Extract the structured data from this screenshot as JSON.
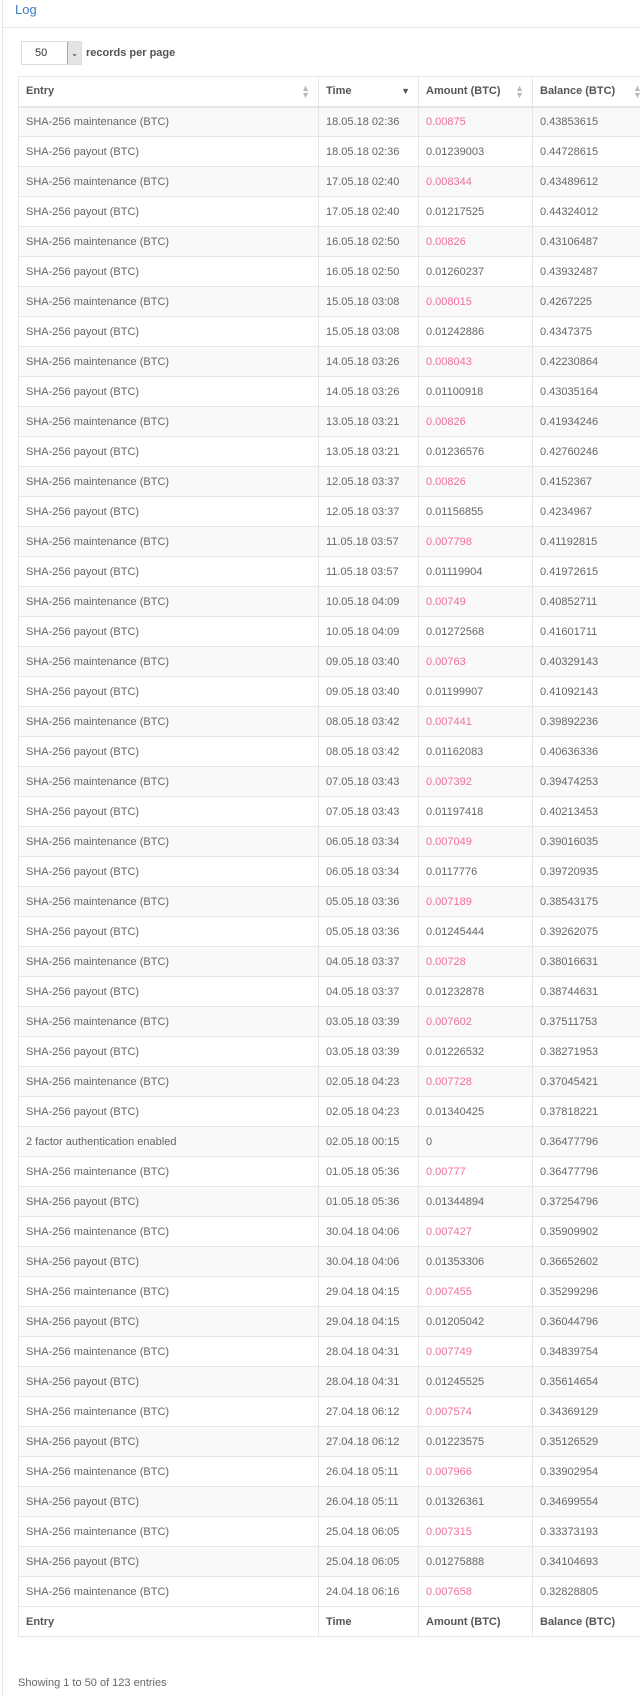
{
  "title": "Log",
  "length_menu": {
    "value": "50",
    "label": "records per page"
  },
  "columns": [
    "Entry",
    "Time",
    "Amount (BTC)",
    "Balance (BTC)"
  ],
  "sort": {
    "column": "Time",
    "direction": "desc"
  },
  "colors": {
    "negative_amount": "#f06ea0",
    "title": "#3b7dc0"
  },
  "rows": [
    {
      "entry": "SHA-256 maintenance (BTC)",
      "time": "18.05.18 02:36",
      "amount": "0.00875",
      "balance": "0.43853615",
      "negative": true
    },
    {
      "entry": "SHA-256 payout (BTC)",
      "time": "18.05.18 02:36",
      "amount": "0.01239003",
      "balance": "0.44728615",
      "negative": false
    },
    {
      "entry": "SHA-256 maintenance (BTC)",
      "time": "17.05.18 02:40",
      "amount": "0.008344",
      "balance": "0.43489612",
      "negative": true
    },
    {
      "entry": "SHA-256 payout (BTC)",
      "time": "17.05.18 02:40",
      "amount": "0.01217525",
      "balance": "0.44324012",
      "negative": false
    },
    {
      "entry": "SHA-256 maintenance (BTC)",
      "time": "16.05.18 02:50",
      "amount": "0.00826",
      "balance": "0.43106487",
      "negative": true
    },
    {
      "entry": "SHA-256 payout (BTC)",
      "time": "16.05.18 02:50",
      "amount": "0.01260237",
      "balance": "0.43932487",
      "negative": false
    },
    {
      "entry": "SHA-256 maintenance (BTC)",
      "time": "15.05.18 03:08",
      "amount": "0.008015",
      "balance": "0.4267225",
      "negative": true
    },
    {
      "entry": "SHA-256 payout (BTC)",
      "time": "15.05.18 03:08",
      "amount": "0.01242886",
      "balance": "0.4347375",
      "negative": false
    },
    {
      "entry": "SHA-256 maintenance (BTC)",
      "time": "14.05.18 03:26",
      "amount": "0.008043",
      "balance": "0.42230864",
      "negative": true
    },
    {
      "entry": "SHA-256 payout (BTC)",
      "time": "14.05.18 03:26",
      "amount": "0.01100918",
      "balance": "0.43035164",
      "negative": false
    },
    {
      "entry": "SHA-256 maintenance (BTC)",
      "time": "13.05.18 03:21",
      "amount": "0.00826",
      "balance": "0.41934246",
      "negative": true
    },
    {
      "entry": "SHA-256 payout (BTC)",
      "time": "13.05.18 03:21",
      "amount": "0.01236576",
      "balance": "0.42760246",
      "negative": false
    },
    {
      "entry": "SHA-256 maintenance (BTC)",
      "time": "12.05.18 03:37",
      "amount": "0.00826",
      "balance": "0.4152367",
      "negative": true
    },
    {
      "entry": "SHA-256 payout (BTC)",
      "time": "12.05.18 03:37",
      "amount": "0.01156855",
      "balance": "0.4234967",
      "negative": false
    },
    {
      "entry": "SHA-256 maintenance (BTC)",
      "time": "11.05.18 03:57",
      "amount": "0.007798",
      "balance": "0.41192815",
      "negative": true
    },
    {
      "entry": "SHA-256 payout (BTC)",
      "time": "11.05.18 03:57",
      "amount": "0.01119904",
      "balance": "0.41972615",
      "negative": false
    },
    {
      "entry": "SHA-256 maintenance (BTC)",
      "time": "10.05.18 04:09",
      "amount": "0.00749",
      "balance": "0.40852711",
      "negative": true
    },
    {
      "entry": "SHA-256 payout (BTC)",
      "time": "10.05.18 04:09",
      "amount": "0.01272568",
      "balance": "0.41601711",
      "negative": false
    },
    {
      "entry": "SHA-256 maintenance (BTC)",
      "time": "09.05.18 03:40",
      "amount": "0.00763",
      "balance": "0.40329143",
      "negative": true
    },
    {
      "entry": "SHA-256 payout (BTC)",
      "time": "09.05.18 03:40",
      "amount": "0.01199907",
      "balance": "0.41092143",
      "negative": false
    },
    {
      "entry": "SHA-256 maintenance (BTC)",
      "time": "08.05.18 03:42",
      "amount": "0.007441",
      "balance": "0.39892236",
      "negative": true
    },
    {
      "entry": "SHA-256 payout (BTC)",
      "time": "08.05.18 03:42",
      "amount": "0.01162083",
      "balance": "0.40636336",
      "negative": false
    },
    {
      "entry": "SHA-256 maintenance (BTC)",
      "time": "07.05.18 03:43",
      "amount": "0.007392",
      "balance": "0.39474253",
      "negative": true
    },
    {
      "entry": "SHA-256 payout (BTC)",
      "time": "07.05.18 03:43",
      "amount": "0.01197418",
      "balance": "0.40213453",
      "negative": false
    },
    {
      "entry": "SHA-256 maintenance (BTC)",
      "time": "06.05.18 03:34",
      "amount": "0.007049",
      "balance": "0.39016035",
      "negative": true
    },
    {
      "entry": "SHA-256 payout (BTC)",
      "time": "06.05.18 03:34",
      "amount": "0.0117776",
      "balance": "0.39720935",
      "negative": false
    },
    {
      "entry": "SHA-256 maintenance (BTC)",
      "time": "05.05.18 03:36",
      "amount": "0.007189",
      "balance": "0.38543175",
      "negative": true
    },
    {
      "entry": "SHA-256 payout (BTC)",
      "time": "05.05.18 03:36",
      "amount": "0.01245444",
      "balance": "0.39262075",
      "negative": false
    },
    {
      "entry": "SHA-256 maintenance (BTC)",
      "time": "04.05.18 03:37",
      "amount": "0.00728",
      "balance": "0.38016631",
      "negative": true
    },
    {
      "entry": "SHA-256 payout (BTC)",
      "time": "04.05.18 03:37",
      "amount": "0.01232878",
      "balance": "0.38744631",
      "negative": false
    },
    {
      "entry": "SHA-256 maintenance (BTC)",
      "time": "03.05.18 03:39",
      "amount": "0.007602",
      "balance": "0.37511753",
      "negative": true
    },
    {
      "entry": "SHA-256 payout (BTC)",
      "time": "03.05.18 03:39",
      "amount": "0.01226532",
      "balance": "0.38271953",
      "negative": false
    },
    {
      "entry": "SHA-256 maintenance (BTC)",
      "time": "02.05.18 04:23",
      "amount": "0.007728",
      "balance": "0.37045421",
      "negative": true
    },
    {
      "entry": "SHA-256 payout (BTC)",
      "time": "02.05.18 04:23",
      "amount": "0.01340425",
      "balance": "0.37818221",
      "negative": false
    },
    {
      "entry": "2 factor authentication enabled",
      "time": "02.05.18 00:15",
      "amount": "0",
      "balance": "0.36477796",
      "negative": false
    },
    {
      "entry": "SHA-256 maintenance (BTC)",
      "time": "01.05.18 05:36",
      "amount": "0.00777",
      "balance": "0.36477796",
      "negative": true
    },
    {
      "entry": "SHA-256 payout (BTC)",
      "time": "01.05.18 05:36",
      "amount": "0.01344894",
      "balance": "0.37254796",
      "negative": false
    },
    {
      "entry": "SHA-256 maintenance (BTC)",
      "time": "30.04.18 04:06",
      "amount": "0.007427",
      "balance": "0.35909902",
      "negative": true
    },
    {
      "entry": "SHA-256 payout (BTC)",
      "time": "30.04.18 04:06",
      "amount": "0.01353306",
      "balance": "0.36652602",
      "negative": false
    },
    {
      "entry": "SHA-256 maintenance (BTC)",
      "time": "29.04.18 04:15",
      "amount": "0.007455",
      "balance": "0.35299296",
      "negative": true
    },
    {
      "entry": "SHA-256 payout (BTC)",
      "time": "29.04.18 04:15",
      "amount": "0.01205042",
      "balance": "0.36044796",
      "negative": false
    },
    {
      "entry": "SHA-256 maintenance (BTC)",
      "time": "28.04.18 04:31",
      "amount": "0.007749",
      "balance": "0.34839754",
      "negative": true
    },
    {
      "entry": "SHA-256 payout (BTC)",
      "time": "28.04.18 04:31",
      "amount": "0.01245525",
      "balance": "0.35614654",
      "negative": false
    },
    {
      "entry": "SHA-256 maintenance (BTC)",
      "time": "27.04.18 06:12",
      "amount": "0.007574",
      "balance": "0.34369129",
      "negative": true
    },
    {
      "entry": "SHA-256 payout (BTC)",
      "time": "27.04.18 06:12",
      "amount": "0.01223575",
      "balance": "0.35126529",
      "negative": false
    },
    {
      "entry": "SHA-256 maintenance (BTC)",
      "time": "26.04.18 05:11",
      "amount": "0.007966",
      "balance": "0.33902954",
      "negative": true
    },
    {
      "entry": "SHA-256 payout (BTC)",
      "time": "26.04.18 05:11",
      "amount": "0.01326361",
      "balance": "0.34699554",
      "negative": false
    },
    {
      "entry": "SHA-256 maintenance (BTC)",
      "time": "25.04.18 06:05",
      "amount": "0.007315",
      "balance": "0.33373193",
      "negative": true
    },
    {
      "entry": "SHA-256 payout (BTC)",
      "time": "25.04.18 06:05",
      "amount": "0.01275888",
      "balance": "0.34104693",
      "negative": false
    },
    {
      "entry": "SHA-256 maintenance (BTC)",
      "time": "24.04.18 06:16",
      "amount": "0.007658",
      "balance": "0.32828805",
      "negative": true
    }
  ],
  "info": "Showing 1 to 50 of 123 entries"
}
